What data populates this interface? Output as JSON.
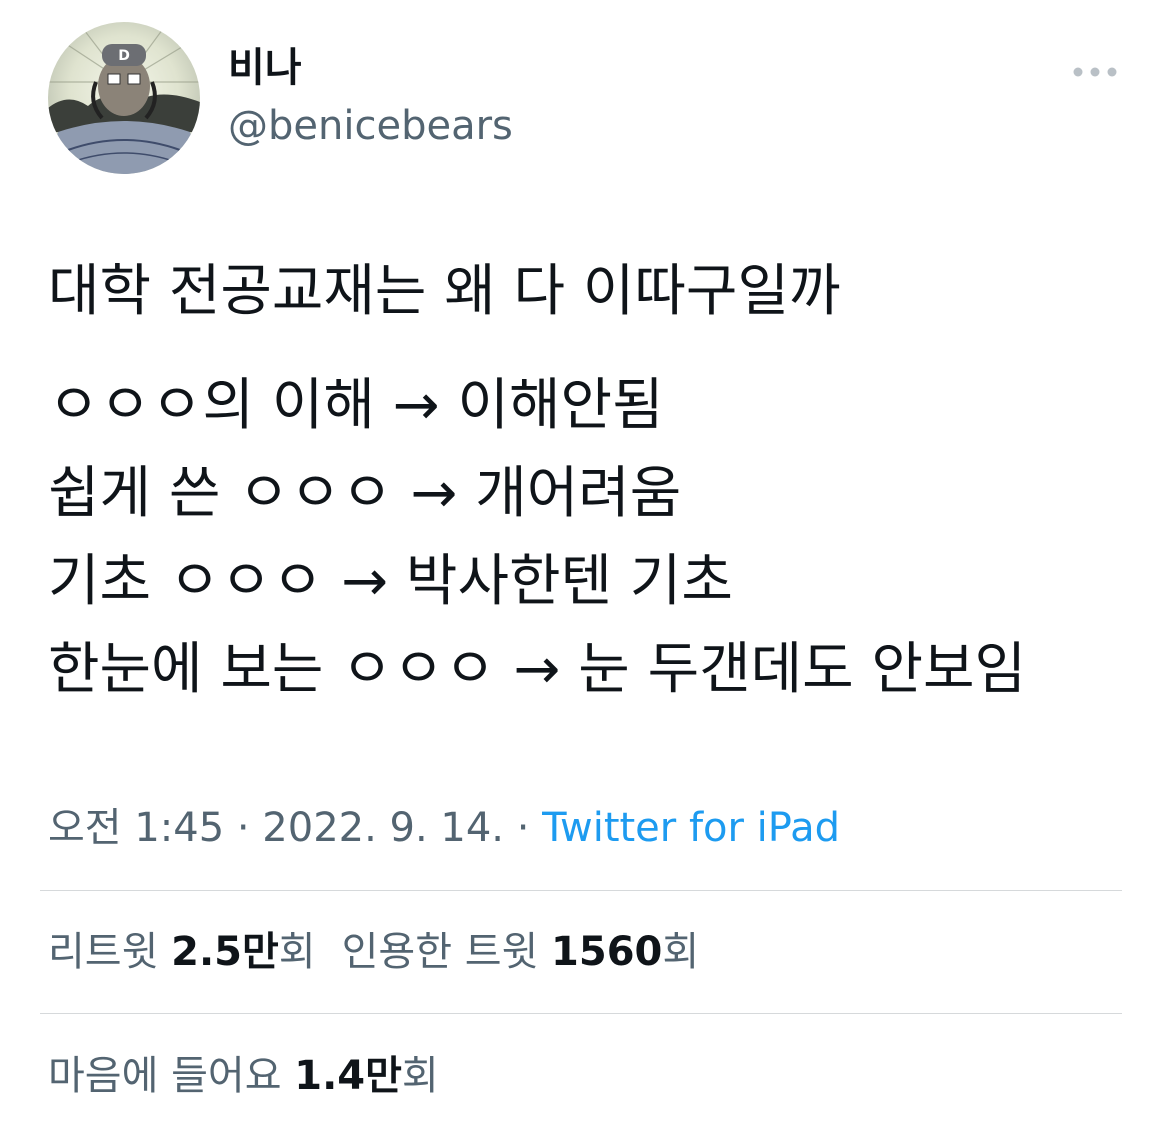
{
  "author": {
    "display_name": "비나",
    "handle": "@benicebears",
    "avatar_icon": "user-avatar-icon"
  },
  "menu": {
    "more_icon": "more-horizontal-icon"
  },
  "tweet": {
    "lines": [
      "대학 전공교재는 왜 다 이따구일까",
      "ㅇㅇㅇ의 이해 → 이해안됨",
      "쉽게 쓴 ㅇㅇㅇ → 개어려움",
      "기초 ㅇㅇㅇ → 박사한텐 기초",
      "한눈에 보는 ㅇㅇㅇ → 눈 두갠데도 안보임"
    ]
  },
  "meta": {
    "time": "오전 1:45",
    "separator": " · ",
    "date": "2022. 9. 14.",
    "source": "Twitter for iPad"
  },
  "stats": {
    "retweets": {
      "label": "리트윗",
      "value": "2.5만",
      "unit": "회"
    },
    "quotes": {
      "label": "인용한 트윗",
      "value": "1560",
      "unit": "회"
    },
    "likes": {
      "label": "마음에 들어요",
      "value": "1.4만",
      "unit": "회"
    }
  },
  "colors": {
    "text": "#0f1419",
    "secondary": "#536471",
    "link": "#1d9bf0",
    "divider": "#d6d9db"
  }
}
